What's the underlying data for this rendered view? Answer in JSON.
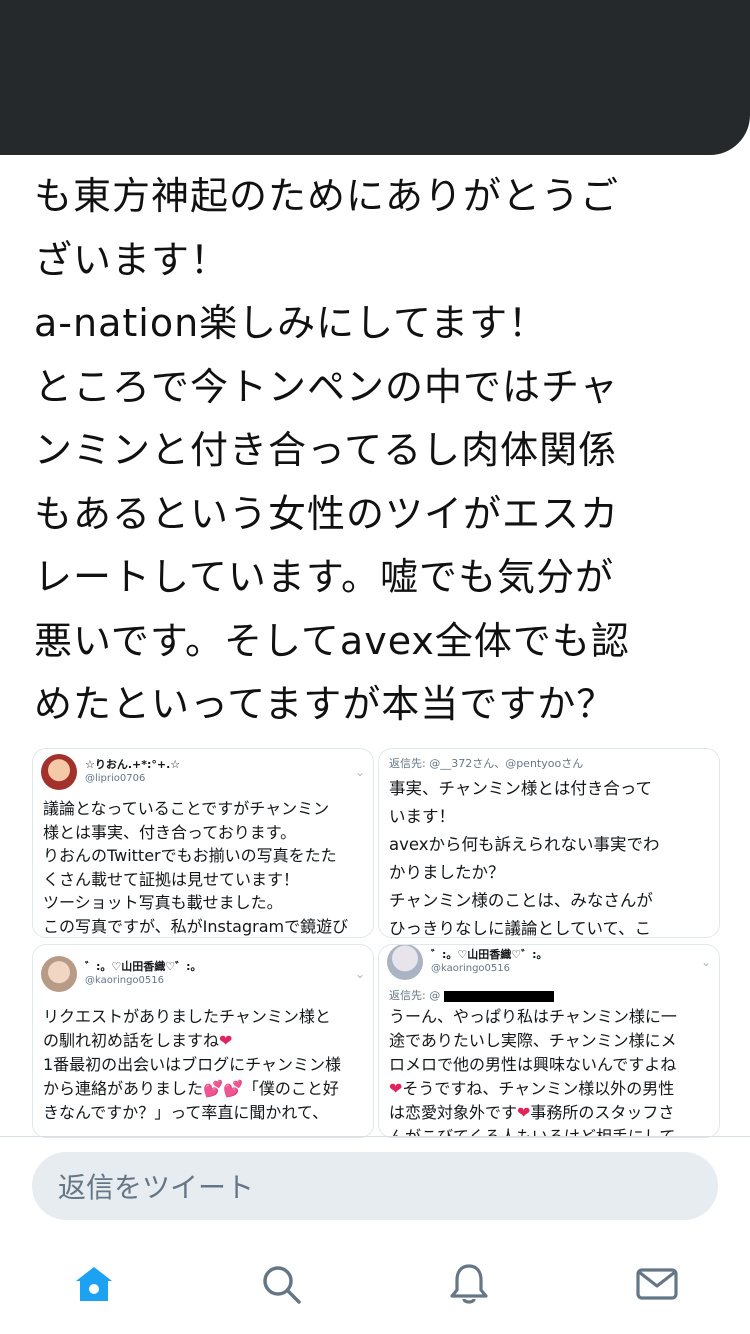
{
  "tweet": {
    "text": "も東方神起のためにありがとうご\nざいます！\na-nation楽しみにしてます！\nところで今トンペンの中ではチャ\nンミンと付き合ってるし肉体関係\nもあるという女性のツイがエスカ\nレートしています。嘘でも気分が\n悪いです。そしてavex全体でも認\nめたといってますが本当ですか？"
  },
  "images": [
    {
      "name": "☆りおん.+*:°+.☆",
      "handle": "@liprio0706",
      "text": "議論となっていることですがチャンミン\n様とは事実、付き合っております。\nりおんのTwitterでもお揃いの写真をたた\nくさん載せて証拠は見せています！\nツーショット写真も載せました。\nこの写真ですが、私がInstagramで鏡遊び\nをした直後チャンミン様が鏡遊びの写真"
    },
    {
      "replyto": "返信先: @__372さん、@pentyooさん",
      "text": "事実、チャンミン様とは付き合って\nいます！\navexから何も訴えられない事実でわ\nかりましたか？\nチャンミン様のことは、みなさんが\nひっきりなしに議論としていて、こ\nれ以上、波紋が広がったら困るので"
    },
    {
      "name": "゛:。♡山田香織♡゛:。",
      "handle": "@kaoringo0516",
      "text_a": "リクエストがありましたチャンミン様と\nの馴れ初め話をしますね",
      "text_b": "\n1番最初の出会いはブログにチャンミン様\nから連絡がありました",
      "text_c": "「僕のこと好\nきなんですか？」って率直に聞かれて、"
    },
    {
      "name": "゛:。♡山田香織♡゛:。",
      "handle": "@kaoringo0516",
      "replyto": "返信先: @",
      "text_a": "うーん、やっぱり私はチャンミン様に一\n途でありたいし実際、チャンミン様にメ\nロメロで他の男性は興味ないんですよね\n",
      "text_b": "そうですね、チャンミン様以外の男性\nは恋愛対象外です",
      "text_c": "事務所のスタッフさ\nんがこびてくる人もいるけど相手にして"
    },
    {
      "hearts": {
        "heart": "❤",
        "two_hearts": "💕💕"
      }
    }
  ],
  "reply": {
    "placeholder": "返信をツイート"
  },
  "tabs": [
    {
      "icon": "home-icon",
      "active": true
    },
    {
      "icon": "search-icon",
      "active": false
    },
    {
      "icon": "notifications-icon",
      "active": false
    },
    {
      "icon": "messages-icon",
      "active": false
    }
  ],
  "colors": {
    "accent": "#1da1f2",
    "icon_gray": "#657786",
    "banner": "#25292c",
    "heart": "#e0245e"
  }
}
